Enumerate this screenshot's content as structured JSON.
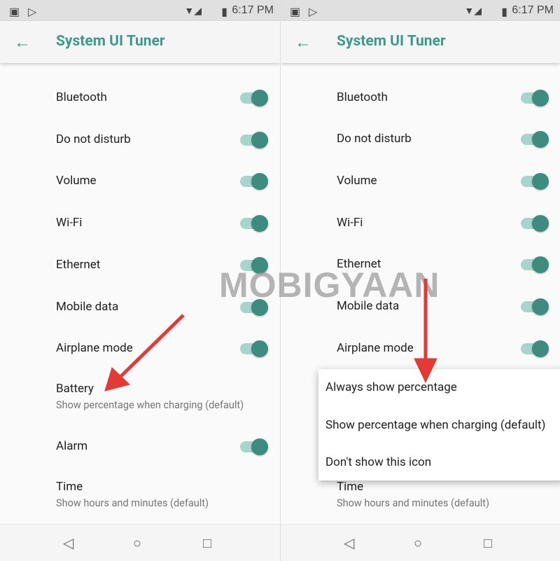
{
  "status": {
    "time": "6:17 PM"
  },
  "toolbar": {
    "title": "System UI Tuner"
  },
  "rows": [
    {
      "label": "Bluetooth",
      "toggle": true
    },
    {
      "label": "Do not disturb",
      "toggle": true
    },
    {
      "label": "Volume",
      "toggle": true
    },
    {
      "label": "Wi-Fi",
      "toggle": true
    },
    {
      "label": "Ethernet",
      "toggle": true
    },
    {
      "label": "Mobile data",
      "toggle": true
    },
    {
      "label": "Airplane mode",
      "toggle": true
    }
  ],
  "battery": {
    "label": "Battery",
    "summary": "Show percentage when charging (default)"
  },
  "alarm": {
    "label": "Alarm",
    "toggle": true
  },
  "time": {
    "label": "Time",
    "summary": "Show hours and minutes (default)"
  },
  "menu": [
    "Always show percentage",
    "Show percentage when charging (default)",
    "Don't show this icon"
  ],
  "watermark": "MOBIGYAAN",
  "colors": {
    "accent": "#3d9a8b",
    "arrow": "#e53935"
  }
}
